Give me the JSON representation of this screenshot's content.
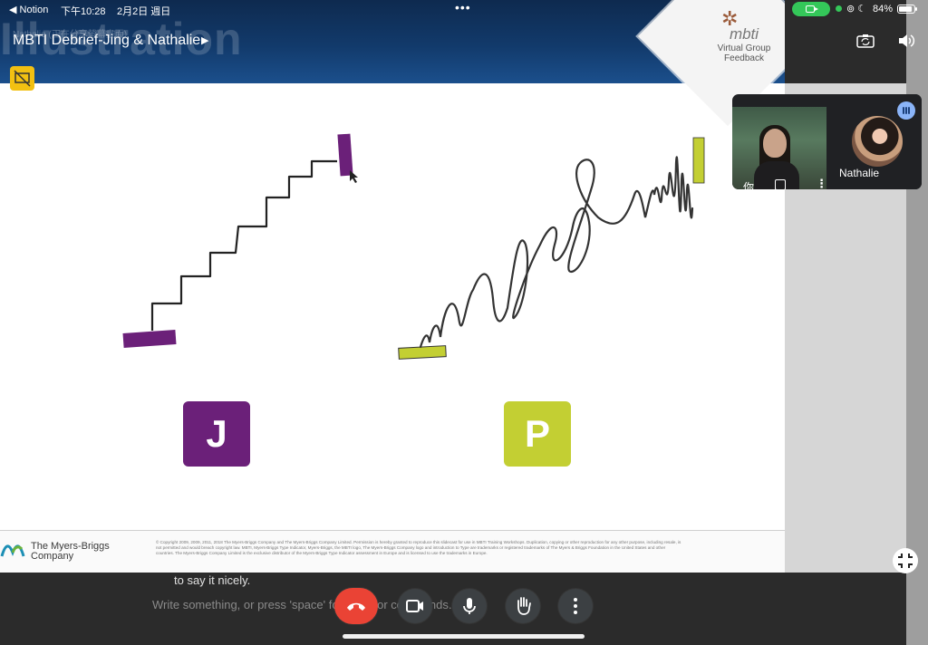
{
  "status_bar": {
    "back_app": "◀ Notion",
    "time": "下午10:28",
    "date": "2月2日 週日",
    "battery": "84%"
  },
  "meeting": {
    "title": "MBTI Debrief-Jing & Nathalie",
    "presenting_notice": "Nathalie (正在分享螢幕畫面)"
  },
  "slide": {
    "header_title": "Illustration",
    "brand_word": "mbti",
    "brand_sub": "Virtual Group Feedback",
    "letter_j": "J",
    "letter_p": "P",
    "colors": {
      "j": "#6b2079",
      "p": "#c3cf33",
      "header": "#123a6b"
    },
    "footer_brand_line1": "The Myers-Briggs",
    "footer_brand_line2": "Company",
    "copyright": "© Copyright 2009, 2009, 2011, 2018 The Myers-Briggs Company and The Myers-Briggs Company Limited. Permission is hereby granted to reproduce this slidecast for use in MBTI Training Workshops. Duplication, copying or other reproduction for any other purpose, including resale, is not permitted and would breach copyright law. MBTI, Myers-Briggs Type Indicator, Myers-Briggs, the MBTI logo, The Myers-Briggs Company logo and introduction to Type are trademarks or registered trademarks of The Myers & Briggs Foundation in the United States and other countries. The Myers-Briggs Company Limited is the exclusive distributor of the Myers-Briggs Type Indicator assessment in Europe and is licensed to use the trademarks in Europe."
  },
  "participants": {
    "self_label": "你",
    "other_name": "Nathalie"
  },
  "notion": {
    "text_line": "to say it nicely.",
    "input_placeholder": "Write something, or press 'space' for AI, '/' for commands..."
  },
  "icons": {
    "end_call": "phone-hangup-icon",
    "camera": "video-camera-icon",
    "mic": "microphone-icon",
    "hand": "raise-hand-icon",
    "more": "more-vertical-icon"
  }
}
